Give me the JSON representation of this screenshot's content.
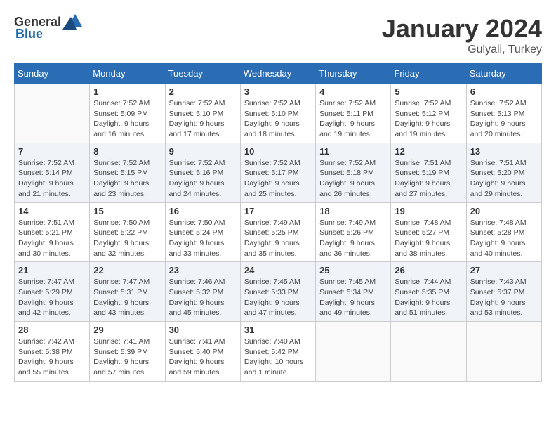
{
  "logo": {
    "general": "General",
    "blue": "Blue"
  },
  "header": {
    "month": "January 2024",
    "location": "Gulyali, Turkey"
  },
  "weekdays": [
    "Sunday",
    "Monday",
    "Tuesday",
    "Wednesday",
    "Thursday",
    "Friday",
    "Saturday"
  ],
  "weeks": [
    [
      {
        "day": "",
        "sunrise": "",
        "sunset": "",
        "daylight": ""
      },
      {
        "day": "1",
        "sunrise": "Sunrise: 7:52 AM",
        "sunset": "Sunset: 5:09 PM",
        "daylight": "Daylight: 9 hours and 16 minutes."
      },
      {
        "day": "2",
        "sunrise": "Sunrise: 7:52 AM",
        "sunset": "Sunset: 5:10 PM",
        "daylight": "Daylight: 9 hours and 17 minutes."
      },
      {
        "day": "3",
        "sunrise": "Sunrise: 7:52 AM",
        "sunset": "Sunset: 5:10 PM",
        "daylight": "Daylight: 9 hours and 18 minutes."
      },
      {
        "day": "4",
        "sunrise": "Sunrise: 7:52 AM",
        "sunset": "Sunset: 5:11 PM",
        "daylight": "Daylight: 9 hours and 19 minutes."
      },
      {
        "day": "5",
        "sunrise": "Sunrise: 7:52 AM",
        "sunset": "Sunset: 5:12 PM",
        "daylight": "Daylight: 9 hours and 19 minutes."
      },
      {
        "day": "6",
        "sunrise": "Sunrise: 7:52 AM",
        "sunset": "Sunset: 5:13 PM",
        "daylight": "Daylight: 9 hours and 20 minutes."
      }
    ],
    [
      {
        "day": "7",
        "sunrise": "Sunrise: 7:52 AM",
        "sunset": "Sunset: 5:14 PM",
        "daylight": "Daylight: 9 hours and 21 minutes."
      },
      {
        "day": "8",
        "sunrise": "Sunrise: 7:52 AM",
        "sunset": "Sunset: 5:15 PM",
        "daylight": "Daylight: 9 hours and 23 minutes."
      },
      {
        "day": "9",
        "sunrise": "Sunrise: 7:52 AM",
        "sunset": "Sunset: 5:16 PM",
        "daylight": "Daylight: 9 hours and 24 minutes."
      },
      {
        "day": "10",
        "sunrise": "Sunrise: 7:52 AM",
        "sunset": "Sunset: 5:17 PM",
        "daylight": "Daylight: 9 hours and 25 minutes."
      },
      {
        "day": "11",
        "sunrise": "Sunrise: 7:52 AM",
        "sunset": "Sunset: 5:18 PM",
        "daylight": "Daylight: 9 hours and 26 minutes."
      },
      {
        "day": "12",
        "sunrise": "Sunrise: 7:51 AM",
        "sunset": "Sunset: 5:19 PM",
        "daylight": "Daylight: 9 hours and 27 minutes."
      },
      {
        "day": "13",
        "sunrise": "Sunrise: 7:51 AM",
        "sunset": "Sunset: 5:20 PM",
        "daylight": "Daylight: 9 hours and 29 minutes."
      }
    ],
    [
      {
        "day": "14",
        "sunrise": "Sunrise: 7:51 AM",
        "sunset": "Sunset: 5:21 PM",
        "daylight": "Daylight: 9 hours and 30 minutes."
      },
      {
        "day": "15",
        "sunrise": "Sunrise: 7:50 AM",
        "sunset": "Sunset: 5:22 PM",
        "daylight": "Daylight: 9 hours and 32 minutes."
      },
      {
        "day": "16",
        "sunrise": "Sunrise: 7:50 AM",
        "sunset": "Sunset: 5:24 PM",
        "daylight": "Daylight: 9 hours and 33 minutes."
      },
      {
        "day": "17",
        "sunrise": "Sunrise: 7:49 AM",
        "sunset": "Sunset: 5:25 PM",
        "daylight": "Daylight: 9 hours and 35 minutes."
      },
      {
        "day": "18",
        "sunrise": "Sunrise: 7:49 AM",
        "sunset": "Sunset: 5:26 PM",
        "daylight": "Daylight: 9 hours and 36 minutes."
      },
      {
        "day": "19",
        "sunrise": "Sunrise: 7:48 AM",
        "sunset": "Sunset: 5:27 PM",
        "daylight": "Daylight: 9 hours and 38 minutes."
      },
      {
        "day": "20",
        "sunrise": "Sunrise: 7:48 AM",
        "sunset": "Sunset: 5:28 PM",
        "daylight": "Daylight: 9 hours and 40 minutes."
      }
    ],
    [
      {
        "day": "21",
        "sunrise": "Sunrise: 7:47 AM",
        "sunset": "Sunset: 5:29 PM",
        "daylight": "Daylight: 9 hours and 42 minutes."
      },
      {
        "day": "22",
        "sunrise": "Sunrise: 7:47 AM",
        "sunset": "Sunset: 5:31 PM",
        "daylight": "Daylight: 9 hours and 43 minutes."
      },
      {
        "day": "23",
        "sunrise": "Sunrise: 7:46 AM",
        "sunset": "Sunset: 5:32 PM",
        "daylight": "Daylight: 9 hours and 45 minutes."
      },
      {
        "day": "24",
        "sunrise": "Sunrise: 7:45 AM",
        "sunset": "Sunset: 5:33 PM",
        "daylight": "Daylight: 9 hours and 47 minutes."
      },
      {
        "day": "25",
        "sunrise": "Sunrise: 7:45 AM",
        "sunset": "Sunset: 5:34 PM",
        "daylight": "Daylight: 9 hours and 49 minutes."
      },
      {
        "day": "26",
        "sunrise": "Sunrise: 7:44 AM",
        "sunset": "Sunset: 5:35 PM",
        "daylight": "Daylight: 9 hours and 51 minutes."
      },
      {
        "day": "27",
        "sunrise": "Sunrise: 7:43 AM",
        "sunset": "Sunset: 5:37 PM",
        "daylight": "Daylight: 9 hours and 53 minutes."
      }
    ],
    [
      {
        "day": "28",
        "sunrise": "Sunrise: 7:42 AM",
        "sunset": "Sunset: 5:38 PM",
        "daylight": "Daylight: 9 hours and 55 minutes."
      },
      {
        "day": "29",
        "sunrise": "Sunrise: 7:41 AM",
        "sunset": "Sunset: 5:39 PM",
        "daylight": "Daylight: 9 hours and 57 minutes."
      },
      {
        "day": "30",
        "sunrise": "Sunrise: 7:41 AM",
        "sunset": "Sunset: 5:40 PM",
        "daylight": "Daylight: 9 hours and 59 minutes."
      },
      {
        "day": "31",
        "sunrise": "Sunrise: 7:40 AM",
        "sunset": "Sunset: 5:42 PM",
        "daylight": "Daylight: 10 hours and 1 minute."
      },
      {
        "day": "",
        "sunrise": "",
        "sunset": "",
        "daylight": ""
      },
      {
        "day": "",
        "sunrise": "",
        "sunset": "",
        "daylight": ""
      },
      {
        "day": "",
        "sunrise": "",
        "sunset": "",
        "daylight": ""
      }
    ]
  ]
}
